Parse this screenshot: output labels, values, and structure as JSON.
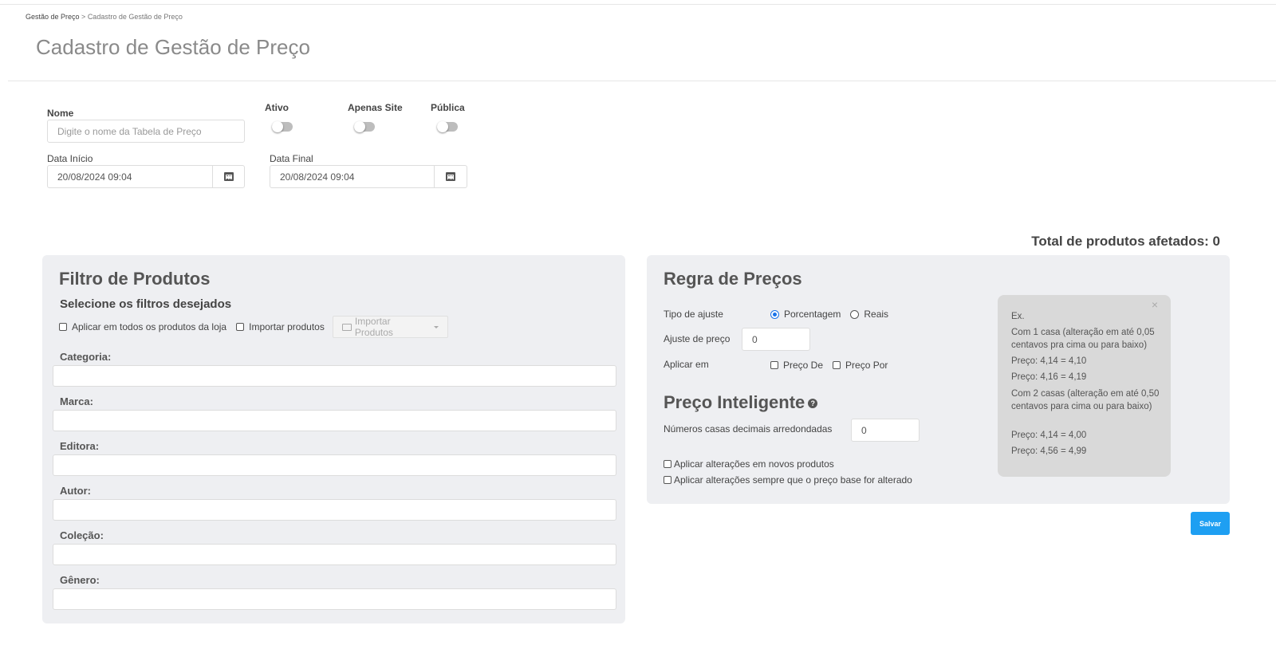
{
  "breadcrumb": {
    "parent": "Gestão de Preço",
    "separator": " > ",
    "current": "Cadastro de Gestão de Preço"
  },
  "page": {
    "title": "Cadastro de Gestão de Preço"
  },
  "form": {
    "name_label": "Nome",
    "name_placeholder": "Digite o nome da Tabela de Preço",
    "toggles": {
      "ativo": "Ativo",
      "apenas_site": "Apenas Site",
      "publica": "Pública"
    },
    "start_label": "Data Início",
    "start_value": "20/08/2024 09:04",
    "end_label": "Data Final",
    "end_value": "20/08/2024 09:04"
  },
  "summary": {
    "total": "Total de produtos afetados: 0"
  },
  "filter": {
    "title": "Filtro de Produtos",
    "subtitle": "Selecione os filtros desejados",
    "apply_all": "Aplicar em todos os produtos da loja",
    "import_check": "Importar produtos",
    "import_button": "Importar Produtos",
    "fields": {
      "categoria": "Categoria:",
      "marca": "Marca:",
      "editora": "Editora:",
      "autor": "Autor:",
      "colecao": "Coleção:",
      "genero": "Gênero:"
    }
  },
  "rules": {
    "title": "Regra de Preços",
    "adjust_type_label": "Tipo de ajuste",
    "opt_percent": "Porcentagem",
    "opt_reais": "Reais",
    "adjust_label": "Ajuste de preço",
    "adjust_value": "0",
    "apply_label": "Aplicar em",
    "preco_de": "Preço De",
    "preco_por": "Preço Por",
    "smart_title": "Preço Inteligente",
    "decimals_label": "Números casas decimais arredondadas",
    "decimals_value": "0",
    "new_products": "Aplicar alterações em novos produtos",
    "base_changed": "Aplicar alterações sempre que o preço base for alterado"
  },
  "info": {
    "close": "×",
    "l1": "Ex.",
    "l2": "Com 1 casa (alteração em até 0,05 centavos pra cima ou para baixo)",
    "l3": "Preço: 4,14 = 4,10",
    "l4": "Preço: 4,16 = 4,19",
    "l5": "Com 2 casas (alteração em até 0,50 centavos para cima ou para baixo)",
    "l6": "Preço: 4,14 = 4,00",
    "l7": "Preço: 4,56 = 4,99"
  },
  "actions": {
    "save": "Salvar"
  }
}
